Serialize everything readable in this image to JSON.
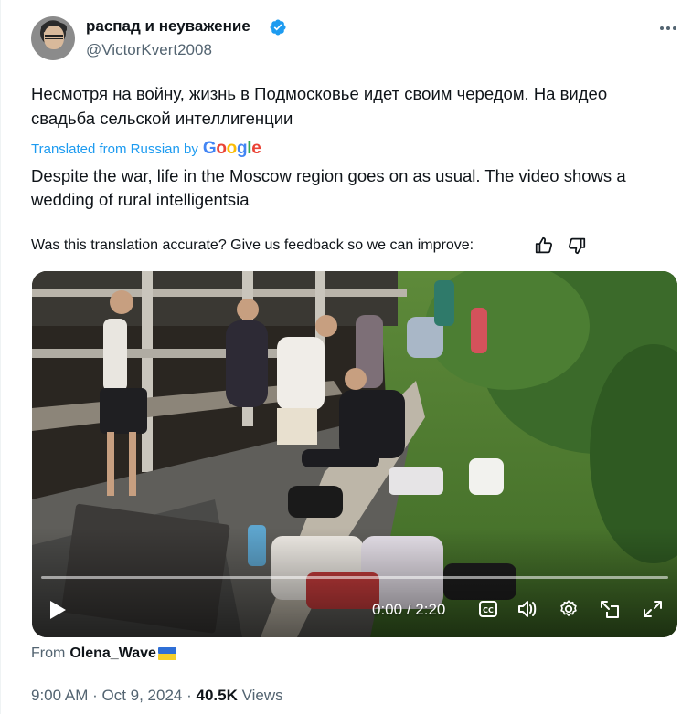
{
  "author": {
    "display_name": "распад и неуважение",
    "handle": "@VictorKvert2008",
    "verified": true,
    "verified_color": "#1d9bf0"
  },
  "tweet": {
    "original_text": "Несмотря на войну, жизнь в Подмосковье идет своим чередом. На видео свадьба сельской интеллигенции",
    "translated_from": "Translated from Russian by",
    "translator": "Google",
    "translated_text": "Despite the war, life in the Moscow region goes on as usual. The video shows a wedding of rural intelligentsia",
    "feedback_prompt": "Was this translation accurate? Give us feedback so we can improve:"
  },
  "video": {
    "time_current": "0:00",
    "time_separator": " / ",
    "time_total": "2:20",
    "progress": 0.0,
    "icons": [
      "play-icon",
      "closed-captions-icon",
      "volume-icon",
      "settings-icon",
      "pop-out-icon",
      "fullscreen-icon"
    ]
  },
  "attribution": {
    "prefix": "From",
    "source": "Olena_Wave",
    "source_flag": "ukraine-flag-icon"
  },
  "meta": {
    "time": "9:00 AM",
    "separator": " · ",
    "date": "Oct 9, 2024",
    "views_count": "40.5K",
    "views_label": " Views"
  },
  "colors": {
    "link": "#1d9bf0",
    "secondary_text": "#536471",
    "primary_text": "#0f1419"
  }
}
